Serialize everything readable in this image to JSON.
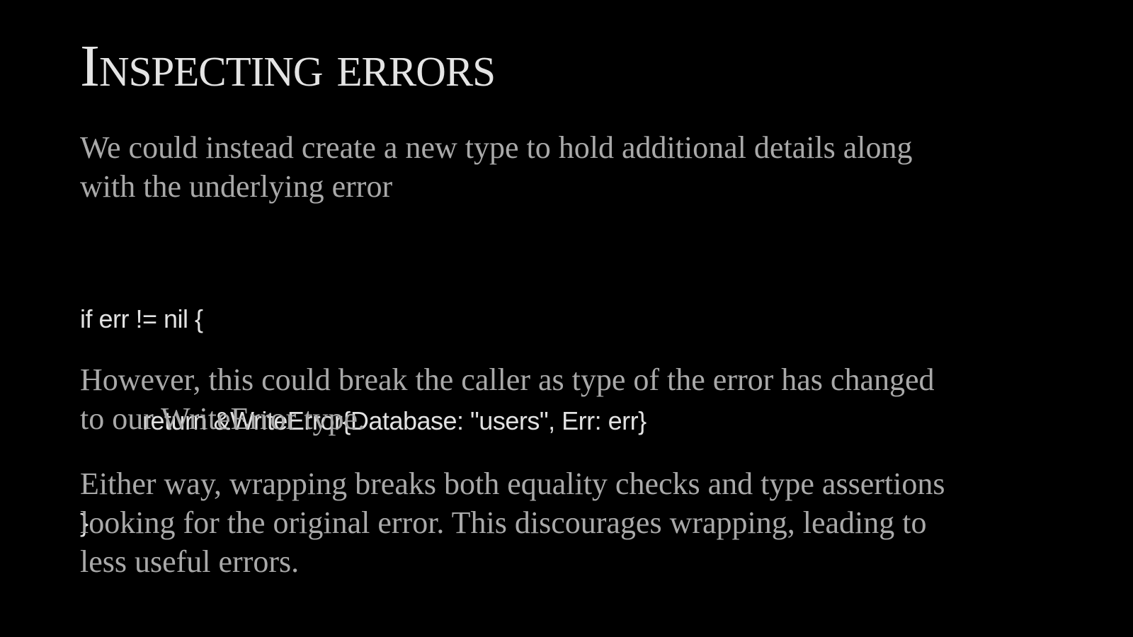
{
  "slide": {
    "title": "Inspecting errors",
    "paragraph1": {
      "lines": [
        "We could instead create a new type to hold additional details along",
        "with the underlying error"
      ]
    },
    "code": {
      "lines": [
        "if err != nil {",
        "return &WriteError{Database: \"users\", Err: err}",
        "}"
      ]
    },
    "paragraph2": {
      "lines": [
        "However, this could break the caller as type of the error has changed",
        "to our WriteError type."
      ]
    },
    "paragraph3": {
      "lines": [
        "Either way, wrapping breaks both equality checks and type assertions",
        "looking for the original error. This discourages wrapping, leading to",
        "less useful errors."
      ]
    }
  }
}
